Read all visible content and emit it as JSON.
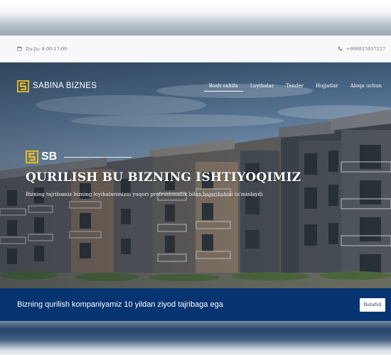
{
  "topbar": {
    "hours": "Du-Ju: 8:00-17:00",
    "phone": "+998915917227",
    "icons": {
      "hours": "calendar-icon",
      "phone": "phone-icon"
    }
  },
  "brand": {
    "name": "SABINA BIZNES",
    "logo_color": "#f2c21b"
  },
  "nav": {
    "items": [
      {
        "label": "Bosh sahifa",
        "active": true
      },
      {
        "label": "Loyihalar"
      },
      {
        "label": "Tender"
      },
      {
        "label": "Hujjatlar"
      },
      {
        "label": "Aloqa uchun"
      }
    ]
  },
  "hero": {
    "badge": "SB",
    "title": "QURILISH BU BIZNING ISHTIYOQIMIZ",
    "subtitle": "Bizning tajribamiz bizning loyihalarimizni yuqori professionallik bilan bajarilishini ta'minlaydi"
  },
  "banner": {
    "text": "Bizning qurilish kompaniyamiz 10 yildan ziyod tajribaga ega",
    "button_label": "Batafsil",
    "background": "#063470"
  }
}
